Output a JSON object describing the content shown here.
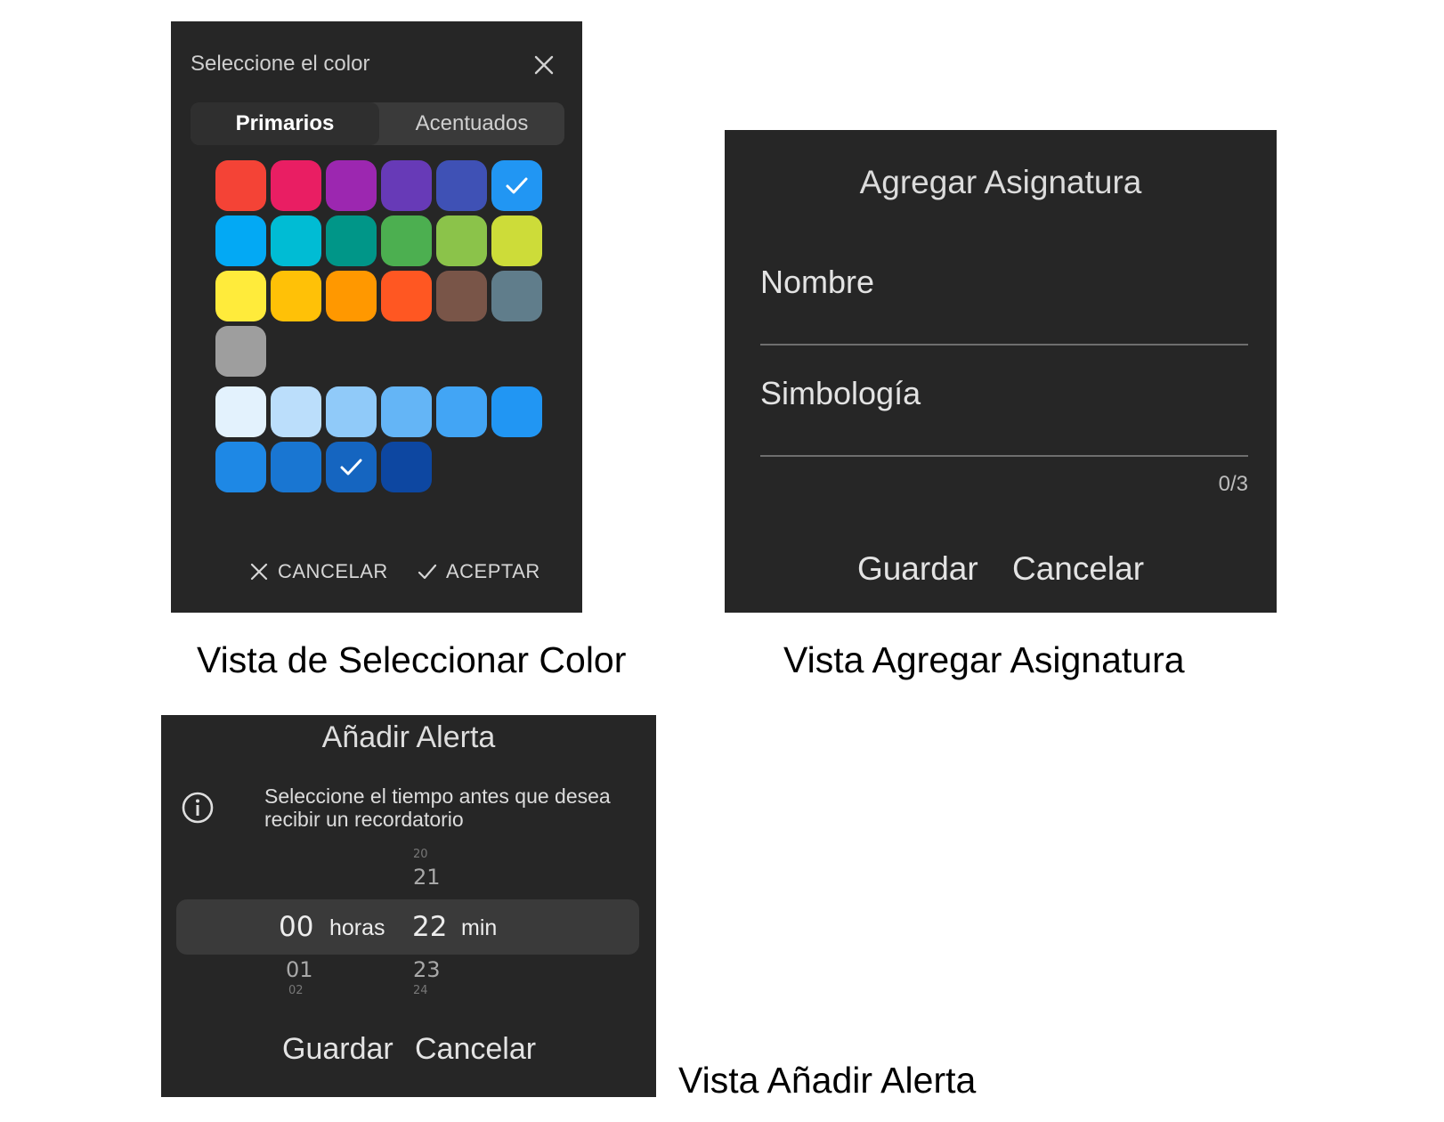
{
  "color_dialog": {
    "title": "Seleccione el color",
    "tabs": [
      "Primarios",
      "Acentuados"
    ],
    "selected_tab": "Primarios",
    "primary_colors": [
      "#f44336",
      "#e91e63",
      "#9c27b0",
      "#673ab7",
      "#3f51b5",
      "#2196f3",
      "#03a9f4",
      "#00bcd4",
      "#009688",
      "#4caf50",
      "#8bc34a",
      "#cddc39",
      "#ffeb3b",
      "#ffc107",
      "#ff9800",
      "#ff5722",
      "#795548",
      "#607d8b",
      "#9e9e9e"
    ],
    "selected_primary": "#2196f3",
    "shade_colors": [
      "#e3f2fd",
      "#bbdefb",
      "#90caf9",
      "#64b5f6",
      "#42a5f5",
      "#2196f3",
      "#1e88e5",
      "#1976d2",
      "#1565c0",
      "#0d47a1"
    ],
    "selected_shade": "#1565c0",
    "cancel_label": "CANCELAR",
    "accept_label": "ACEPTAR"
  },
  "subject_dialog": {
    "title": "Agregar Asignatura",
    "name_label": "Nombre",
    "symbol_label": "Simbología",
    "counter": "0/3",
    "save_label": "Guardar",
    "cancel_label": "Cancelar"
  },
  "alert_dialog": {
    "title": "Añadir Alerta",
    "info_text": "Seleccione el tiempo antes que desea recibir un recordatorio",
    "hours_above": "",
    "hours_value": "00",
    "hours_unit": "horas",
    "hours_below": "01",
    "minutes_above": "21",
    "minutes_value": "22",
    "minutes_unit": "min",
    "minutes_below": "23",
    "save_label": "Guardar",
    "cancel_label": "Cancelar"
  },
  "captions": {
    "color": "Vista de Seleccionar Color",
    "subject": "Vista Agregar Asignatura",
    "alert": "Vista Añadir Alerta"
  }
}
